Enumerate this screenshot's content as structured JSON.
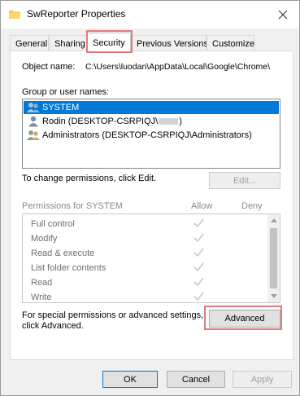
{
  "window": {
    "title": "SwReporter Properties",
    "icon": "folder-icon",
    "close_icon": "close-icon"
  },
  "tabs": [
    {
      "label": "General"
    },
    {
      "label": "Sharing"
    },
    {
      "label": "Security",
      "active": true
    },
    {
      "label": "Previous Versions"
    },
    {
      "label": "Customize"
    }
  ],
  "security": {
    "object_name_label": "Object name:",
    "object_name_value": "C:\\Users\\luodan\\AppData\\Local\\Google\\Chrome\\",
    "group_label": "Group or user names:",
    "users": [
      {
        "name": "SYSTEM",
        "selected": true
      },
      {
        "name_prefix": "Rodin (DESKTOP-CSRPIQJ\\",
        "name_suffix": ")"
      },
      {
        "name": "Administrators (DESKTOP-CSRPIQJ\\Administrators)"
      }
    ],
    "change_hint": "To change permissions, click Edit.",
    "edit_button": "Edit...",
    "permissions_label": "Permissions for SYSTEM",
    "allow_header": "Allow",
    "deny_header": "Deny",
    "permissions": [
      {
        "name": "Full control",
        "allow": true,
        "deny": false
      },
      {
        "name": "Modify",
        "allow": true,
        "deny": false
      },
      {
        "name": "Read & execute",
        "allow": true,
        "deny": false
      },
      {
        "name": "List folder contents",
        "allow": true,
        "deny": false
      },
      {
        "name": "Read",
        "allow": true,
        "deny": false
      },
      {
        "name": "Write",
        "allow": true,
        "deny": false
      }
    ],
    "advanced_hint_line1": "For special permissions or advanced settings,",
    "advanced_hint_line2": "click Advanced.",
    "advanced_button": "Advanced"
  },
  "footer": {
    "ok": "OK",
    "cancel": "Cancel",
    "apply": "Apply"
  },
  "colors": {
    "selection": "#0078d7",
    "highlight_annotation": "#e37a7a",
    "checkmark": "#c8c8c8"
  }
}
